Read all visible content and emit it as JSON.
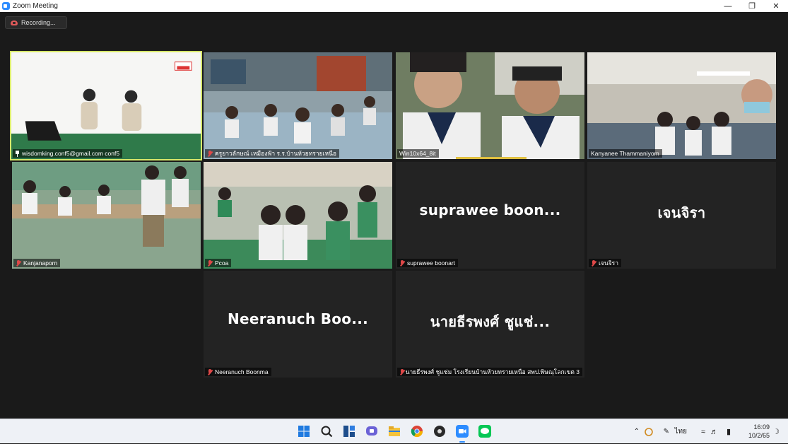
{
  "window": {
    "title": "Zoom Meeting",
    "minimize_icon": "minimize-icon",
    "maximize_icon": "restore-icon",
    "close_icon": "close-icon"
  },
  "recording": {
    "label": "Recording...",
    "icon": "cloud-record-icon",
    "color": "#e05a5a"
  },
  "accent": {
    "active_speaker_border": "#d7e86a",
    "muted_mic": "#e04848"
  },
  "participants": [
    {
      "name": "wisdomking.conf5@gmail.com conf5",
      "type": "video",
      "muted": false,
      "pinned": true,
      "active_speaker": true
    },
    {
      "name": "ครูยาวลักษณ์ เหมืองฟ้า ร.ร.บ้านห้วยทรายเหนือ",
      "type": "video",
      "muted": true
    },
    {
      "name": "Win10x64_8it",
      "type": "video",
      "muted": false
    },
    {
      "name": "Kanyanee Thammaniyom",
      "type": "video",
      "muted": false
    },
    {
      "name": "Kanjanaporn",
      "type": "video",
      "muted": true
    },
    {
      "name": "Pcoa",
      "type": "video",
      "muted": true
    },
    {
      "name": "suprawee boonart",
      "display": "suprawee  boon...",
      "type": "name",
      "muted": true
    },
    {
      "name": "เจนจิรา",
      "display": "เจนจิรา",
      "type": "name",
      "muted": true
    },
    {
      "name": "Neeranuch Boonma",
      "display": "Neeranuch  Boo...",
      "type": "name",
      "muted": true
    },
    {
      "name": "นายธีรพงศ์ ชูแช่ม โรงเรียนบ้านห้วยทรายเหนือ สพป.พิษณุโลกเขต 3",
      "display": "นายธีรพงศ์ ชูแช่...",
      "type": "name",
      "muted": true
    }
  ],
  "taskbar": {
    "apps": [
      "start-icon",
      "search-icon",
      "widgets-icon",
      "chat-icon",
      "file-explorer-icon",
      "chrome-icon",
      "app-icon",
      "zoom-icon",
      "line-icon"
    ],
    "tray": {
      "language": "ไทย",
      "time": "16:09",
      "date": "10/2/65"
    }
  }
}
